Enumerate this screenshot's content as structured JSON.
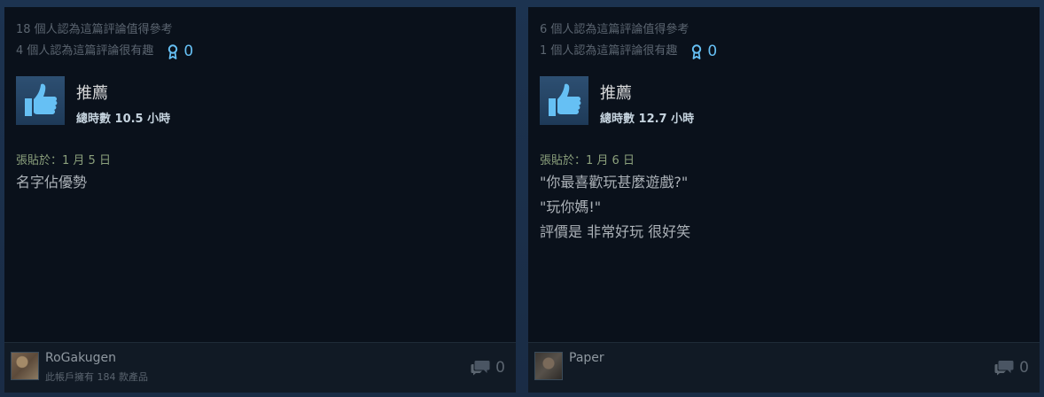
{
  "colors": {
    "background": "#1b2838",
    "card": "#0a111b",
    "accent_blue": "#66c0f4",
    "posted_green": "#8ba07c"
  },
  "reviews": [
    {
      "helpful_text": "18 個人認為這篇評論值得參考",
      "funny_text": "4 個人認為這篇評論很有趣",
      "award_count": "0",
      "recommend_label": "推薦",
      "hours_prefix": "總時數 ",
      "hours_value": "10.5",
      "hours_suffix": " 小時",
      "posted": "張貼於：1 月 5 日",
      "content": [
        "名字佔優勢"
      ],
      "user": {
        "name": "RoGakugen",
        "products": "此帳戶擁有 184 款產品"
      },
      "comment_count": "0"
    },
    {
      "helpful_text": "6 個人認為這篇評論值得參考",
      "funny_text": "1 個人認為這篇評論很有趣",
      "award_count": "0",
      "recommend_label": "推薦",
      "hours_prefix": "總時數 ",
      "hours_value": "12.7",
      "hours_suffix": " 小時",
      "posted": "張貼於：1 月 6 日",
      "content": [
        "\"你最喜歡玩甚麼遊戲?\"",
        "\"玩你媽!\"",
        "評價是 非常好玩 很好笑"
      ],
      "user": {
        "name": "Paper",
        "products": ""
      },
      "comment_count": "0"
    }
  ],
  "icons": {
    "thumbs_up": "thumbs-up-icon",
    "award": "award-ribbon-icon",
    "comment": "comment-bubble-icon"
  }
}
